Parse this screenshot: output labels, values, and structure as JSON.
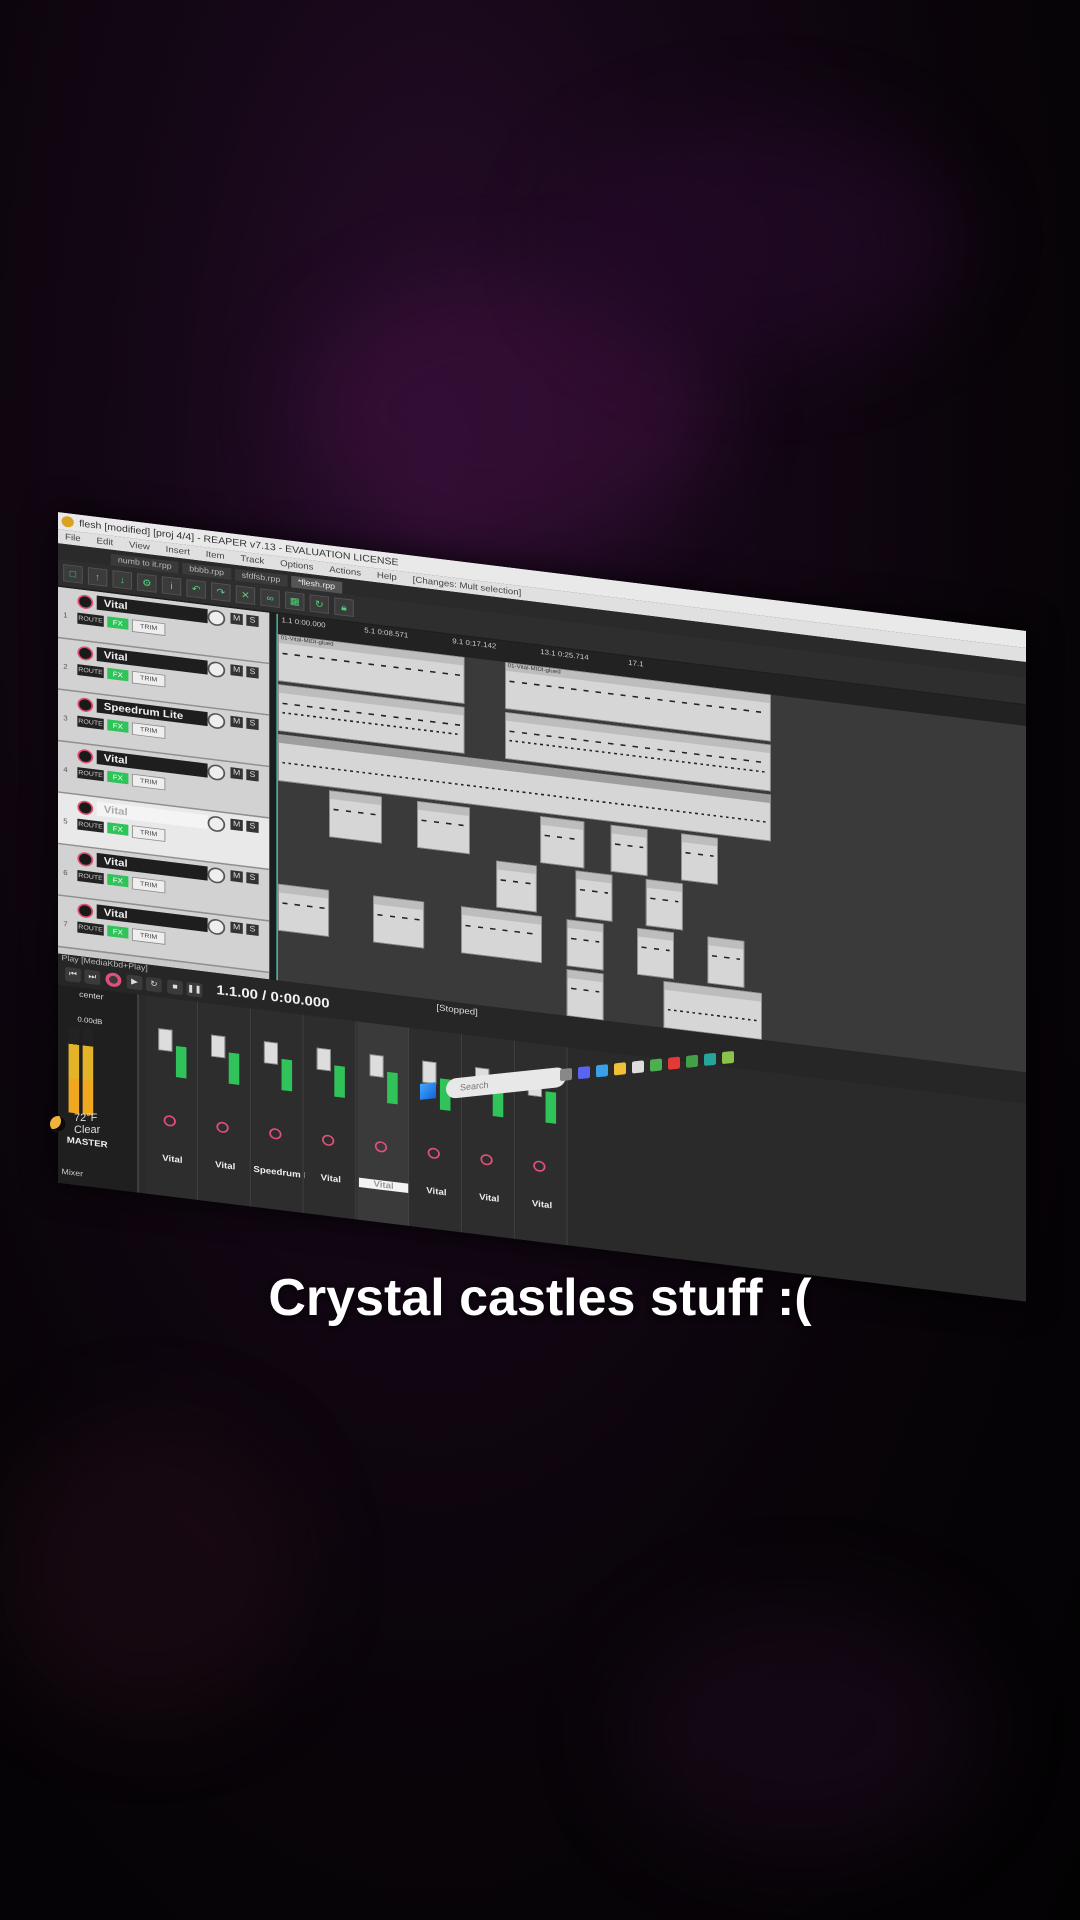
{
  "window": {
    "title": "flesh [modified] [proj 4/4] - REAPER v7.13 - EVALUATION LICENSE",
    "menu": [
      "File",
      "Edit",
      "View",
      "Insert",
      "Item",
      "Track",
      "Options",
      "Actions",
      "Help"
    ],
    "menu_status": "[Changes: Mult selection]",
    "tabs": [
      "numb to it.rpp",
      "bbbb.rpp",
      "sfdfsb.rpp",
      "*flesh.rpp"
    ]
  },
  "tracks": [
    {
      "name": "Vital",
      "num": "1",
      "route": "ROUTE",
      "fx": "FX",
      "trim": "TRIM",
      "m": "M",
      "s": "S"
    },
    {
      "name": "Vital",
      "num": "2",
      "route": "ROUTE",
      "fx": "FX",
      "trim": "TRIM",
      "m": "M",
      "s": "S"
    },
    {
      "name": "Speedrum Lite",
      "num": "3",
      "route": "ROUTE",
      "fx": "FX",
      "trim": "TRIM",
      "m": "M",
      "s": "S"
    },
    {
      "name": "Vital",
      "num": "4",
      "route": "ROUTE",
      "fx": "FX",
      "trim": "TRIM",
      "m": "M",
      "s": "S"
    },
    {
      "name": "Vital",
      "num": "5",
      "route": "ROUTE",
      "fx": "FX",
      "trim": "TRIM",
      "m": "M",
      "s": "S"
    },
    {
      "name": "Vital",
      "num": "6",
      "route": "ROUTE",
      "fx": "FX",
      "trim": "TRIM",
      "m": "M",
      "s": "S"
    },
    {
      "name": "Vital",
      "num": "7",
      "route": "ROUTE",
      "fx": "FX",
      "trim": "TRIM",
      "m": "M",
      "s": "S"
    }
  ],
  "ruler": [
    "1.1\n0:00.000",
    "5.1\n0:08.571",
    "9.1\n0:17.142",
    "13.1\n0:25.714",
    "17.1"
  ],
  "item_label": "01-Vital-MIDI-glued",
  "transport": {
    "hint": "Play [MediaKbd+Play]",
    "time": "1.1.00 / 0:00.000",
    "state": "[Stopped]"
  },
  "mixer": {
    "master_pan": "center",
    "master_db": "0.00dB",
    "master_label": "MASTER",
    "mixer_label": "Mixer",
    "strips": [
      "Vital",
      "Vital",
      "Speedrum Lit",
      "Vital",
      "Vital",
      "Vital",
      "Vital",
      "Vital"
    ]
  },
  "taskbar": {
    "search_placeholder": "Search"
  },
  "weather": {
    "temp": "72°F",
    "condition": "Clear"
  },
  "caption": "Crystal castles stuff :("
}
